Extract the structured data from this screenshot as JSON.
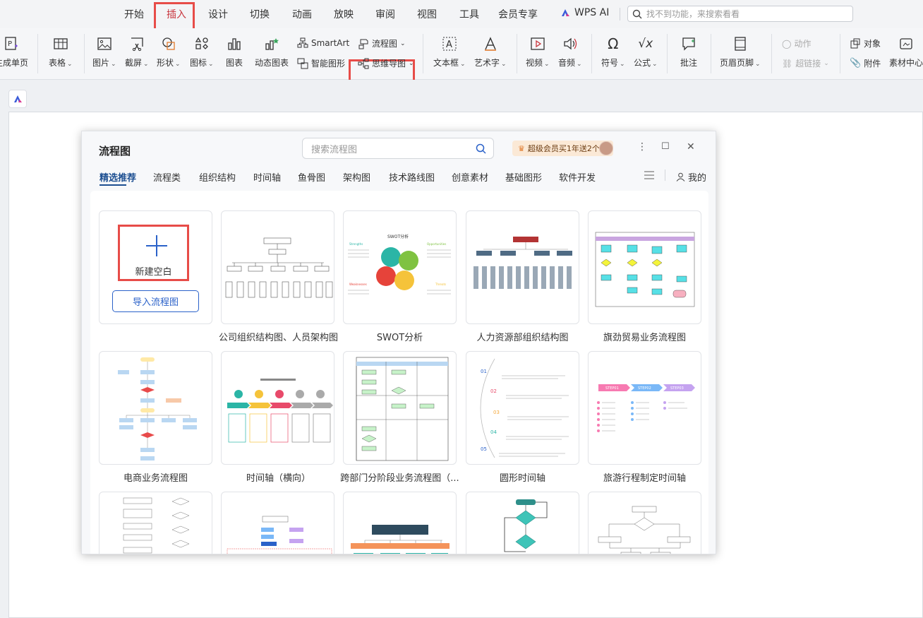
{
  "menubar": {
    "items": [
      "开始",
      "插入",
      "设计",
      "切换",
      "动画",
      "放映",
      "审阅",
      "视图",
      "工具",
      "会员专享"
    ],
    "active": "插入",
    "ai_label": "WPS AI",
    "search_placeholder": "找不到功能，来搜索看看"
  },
  "ribbon": {
    "new_page": "生成单页",
    "table": "表格",
    "picture": "图片",
    "screenshot": "截屏",
    "shape": "形状",
    "icon": "图标",
    "chart": "图表",
    "dyn_chart": "动态图表",
    "smartart": "SmartArt",
    "smart_shape": "智能图形",
    "flowchart": "流程图",
    "mindmap": "思维导图",
    "textbox": "文本框",
    "wordart": "艺术字",
    "video": "视频",
    "audio": "音频",
    "symbol": "符号",
    "formula": "公式",
    "comment": "批注",
    "header_footer": "页眉页脚",
    "action": "动作",
    "hyperlink": "超链接",
    "object": "对象",
    "attachment": "附件",
    "material": "素材中心"
  },
  "dialog": {
    "title": "流程图",
    "search_placeholder": "搜索流程图",
    "vip_text": "超级会员买1年送2个月",
    "tabs": [
      "精选推荐",
      "流程类",
      "组织结构",
      "时间轴",
      "鱼骨图",
      "架构图",
      "技术路线图",
      "创意素材",
      "基础图形",
      "软件开发"
    ],
    "mine": "我的",
    "new_blank": "新建空白",
    "import": "导入流程图",
    "cards": [
      "公司组织结构图、人员架构图",
      "SWOT分析",
      "人力资源部组织结构图",
      "旗劲贸易业务流程图",
      "电商业务流程图",
      "时间轴（横向）",
      "跨部门分阶段业务流程图（...",
      "圆形时间轴",
      "旅游行程制定时间轴"
    ],
    "swot": {
      "title": "SWOT分析",
      "s": "Strengths",
      "w": "Weaknesses",
      "o": "Opportunities",
      "t": "Threats"
    },
    "steps": [
      "STEP01",
      "STEP02",
      "STEP03"
    ],
    "timeline_nums": [
      "01",
      "02",
      "03",
      "04",
      "05"
    ]
  },
  "colors": {
    "accent": "#c8373f",
    "highlight": "#e74c48",
    "link": "#2b62c9",
    "tab_active": "#1d4f91"
  }
}
